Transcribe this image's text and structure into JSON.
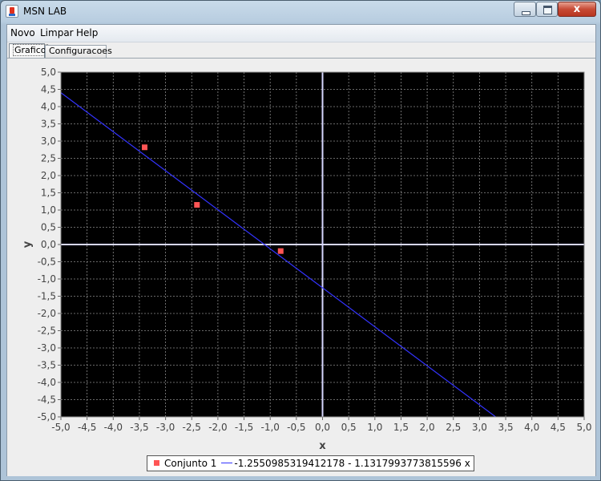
{
  "window": {
    "title": "MSN LAB",
    "controls": {
      "minimize": "",
      "maximize": "",
      "close": "x"
    }
  },
  "menu": {
    "items": [
      "Novo",
      "Limpar",
      "Help"
    ]
  },
  "tabs": [
    {
      "label": "Grafico",
      "selected": true
    },
    {
      "label": "Configuracoes",
      "selected": false
    }
  ],
  "chart_data": {
    "type": "scatter",
    "xlabel": "x",
    "ylabel": "y",
    "xlim": [
      -5.0,
      5.0
    ],
    "ylim": [
      -5.0,
      5.0
    ],
    "x_ticks": [
      "-5,0",
      "-4,5",
      "-4,0",
      "-3,5",
      "-3,0",
      "-2,5",
      "-2,0",
      "-1,5",
      "-1,0",
      "-0,5",
      "0,0",
      "0,5",
      "1,0",
      "1,5",
      "2,0",
      "2,5",
      "3,0",
      "3,5",
      "4,0",
      "4,5",
      "5,0"
    ],
    "y_ticks": [
      "5,0",
      "4,5",
      "4,0",
      "3,5",
      "3,0",
      "2,5",
      "2,0",
      "1,5",
      "1,0",
      "0,5",
      "0,0",
      "-0,5",
      "-1,0",
      "-1,5",
      "-2,0",
      "-2,5",
      "-3,0",
      "-3,5",
      "-4,0",
      "-4,5",
      "-5,0"
    ],
    "grid": true,
    "background": "#000000",
    "series": [
      {
        "name": "Conjunto 1",
        "kind": "points",
        "color": "#ff5555",
        "x": [
          -3.4,
          -2.4,
          -0.8
        ],
        "y": [
          2.82,
          1.15,
          -0.19
        ]
      },
      {
        "name": "-1.2550985319412178 - 1.1317993773815596 x",
        "kind": "line",
        "color": "#3333ff",
        "intercept": -1.2550985319412178,
        "slope": -1.1317993773815596
      }
    ],
    "legend": {
      "position": "bottom-center"
    }
  }
}
